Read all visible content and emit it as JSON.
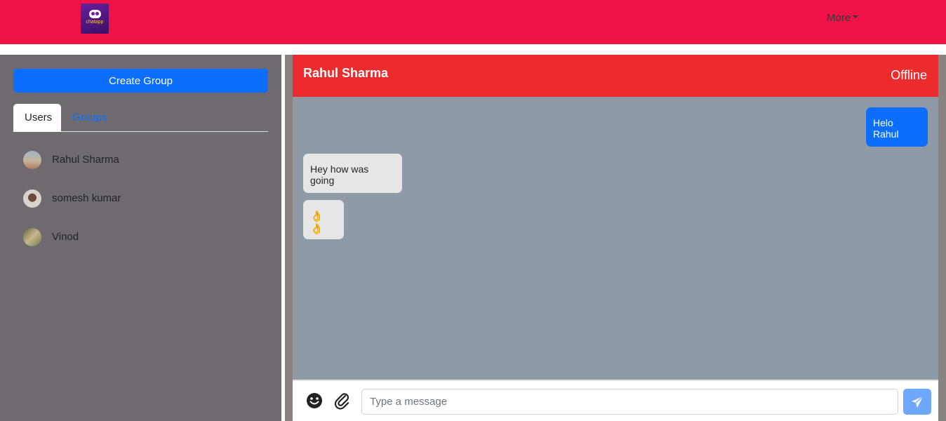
{
  "navbar": {
    "logo_text": "chatapp",
    "more_label": "More"
  },
  "sidebar": {
    "create_group_label": "Create Group",
    "tabs": [
      {
        "label": "Users",
        "active": true
      },
      {
        "label": "Groups",
        "active": false
      }
    ],
    "users": [
      {
        "name": "Rahul Sharma"
      },
      {
        "name": "somesh kumar"
      },
      {
        "name": "Vinod"
      }
    ]
  },
  "chat": {
    "contact_name": "Rahul Sharma",
    "status": "Offline",
    "messages": [
      {
        "direction": "outgoing",
        "text": "Helo Rahul"
      },
      {
        "direction": "incoming",
        "text": "Hey how was going"
      },
      {
        "direction": "incoming",
        "text": "👌 👌"
      }
    ],
    "composer": {
      "placeholder": "Type a message",
      "value": "",
      "emoji_icon": "emoji-icon",
      "attach_icon": "paperclip-icon",
      "send_icon": "send-icon"
    }
  },
  "colors": {
    "navbar": "#ef1247",
    "chat_header": "#ec2c2c",
    "primary": "#0d6efd",
    "sidebar_bg": "#6e6a6f",
    "messages_bg": "#8e9aa6"
  }
}
